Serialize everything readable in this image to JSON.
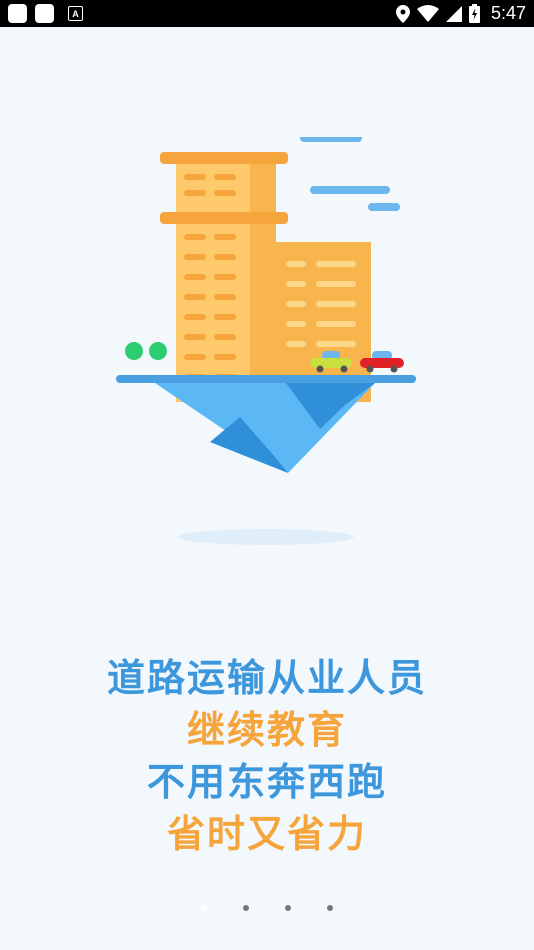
{
  "status_bar": {
    "time": "5:47",
    "icons": [
      "square-icon",
      "square-icon",
      "a-notification-icon",
      "location-icon",
      "wifi-icon",
      "cell-signal-icon",
      "battery-icon"
    ]
  },
  "splash": {
    "line1": "道路运输从业人员",
    "line2": "继续教育",
    "line3": "不用东奔西跑",
    "line4": "省时又省力"
  },
  "colors": {
    "blue": "#3c97dc",
    "orange": "#f6a53c",
    "background": "#f3f8fd"
  },
  "pager": {
    "total_pages": 4,
    "current_page": 1
  }
}
